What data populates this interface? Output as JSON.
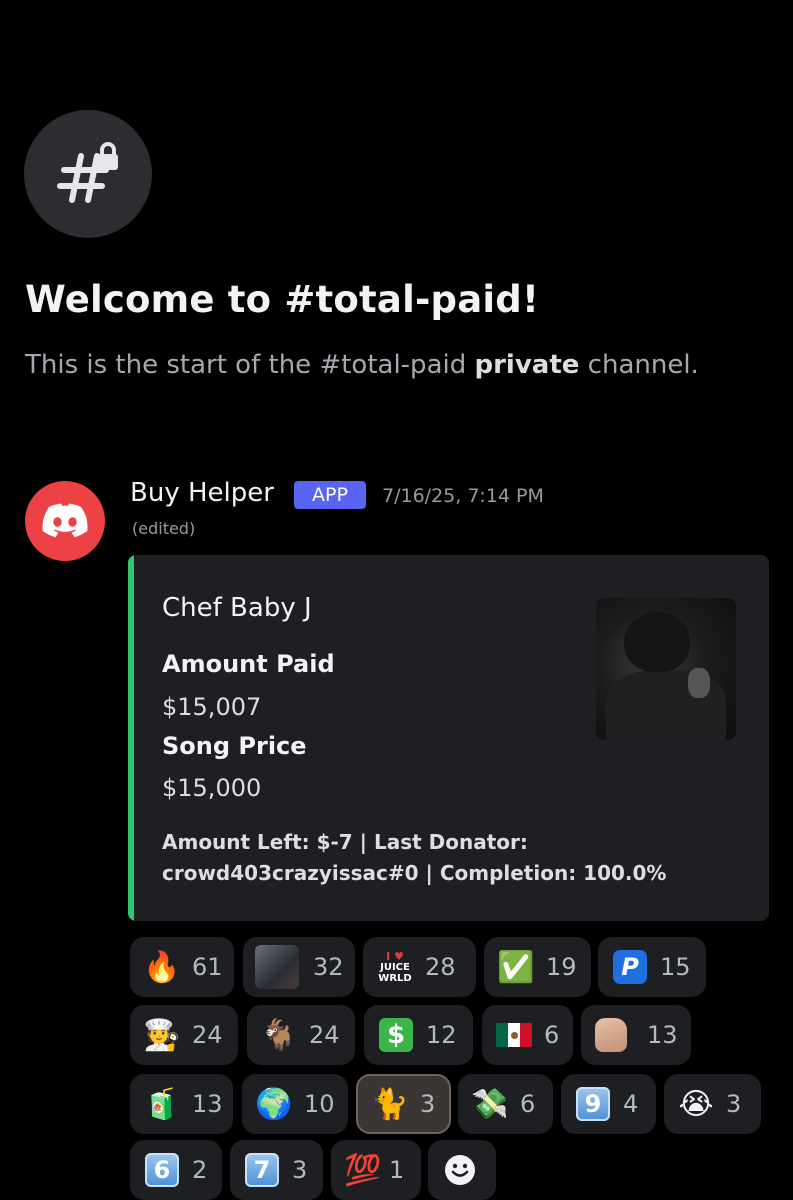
{
  "welcome": {
    "title": "Welcome to #total-paid!",
    "subtitle_start": "This is the start of the #total-paid ",
    "subtitle_bold": "private",
    "subtitle_end": " channel."
  },
  "message": {
    "author": "Buy Helper",
    "badge": "APP",
    "timestamp": "7/16/25, 7:14 PM",
    "edited": "(edited)",
    "embed": {
      "accent_color": "#2dc770",
      "title": "Chef Baby J",
      "fields": [
        {
          "name": "Amount Paid",
          "value": "$15,007"
        },
        {
          "name": "Song Price",
          "value": "$15,000"
        }
      ],
      "description_line1": "Amount Left: $-7 | Last Donator:",
      "description_line2": "crowd403crazyissac#0 | Completion: 100.0%"
    }
  },
  "reactions": [
    {
      "icon": "fire",
      "glyph": "🔥",
      "count": "61"
    },
    {
      "icon": "photo",
      "count": "32"
    },
    {
      "icon": "juice-wrld-logo",
      "logo_top": "I ♥",
      "logo_mid": "JUICE",
      "logo_bot": "WRLD",
      "count": "28"
    },
    {
      "icon": "check-mark",
      "glyph": "✅",
      "count": "19"
    },
    {
      "icon": "paypal",
      "glyph": "P",
      "count": "15"
    },
    {
      "icon": "cook",
      "glyph": "🧑‍🍳",
      "count": "24"
    },
    {
      "icon": "goat",
      "glyph": "🐐",
      "count": "24"
    },
    {
      "icon": "dollar",
      "glyph": "$",
      "count": "12"
    },
    {
      "icon": "mexico-flag",
      "glyph": "🇲🇽",
      "count": "6"
    },
    {
      "icon": "fist",
      "count": "13"
    },
    {
      "icon": "juice-box",
      "glyph": "🧃",
      "count": "13"
    },
    {
      "icon": "globe",
      "glyph": "🌍",
      "count": "10"
    },
    {
      "icon": "cat",
      "glyph": "🐈",
      "count": "3"
    },
    {
      "icon": "money-wings",
      "glyph": "💸",
      "count": "6"
    },
    {
      "icon": "keycap-nine",
      "glyph": "9",
      "count": "4"
    },
    {
      "icon": "crying-face",
      "glyph": "😭",
      "count": "3"
    },
    {
      "icon": "keycap-six",
      "glyph": "6",
      "count": "2"
    },
    {
      "icon": "keycap-seven",
      "glyph": "7",
      "count": "3"
    },
    {
      "icon": "hundred-points",
      "glyph": "💯",
      "count": "1"
    }
  ],
  "colors": {
    "background": "#000000",
    "embed_bg": "#1e1f22",
    "badge": "#5865f2",
    "avatar": "#ed4245"
  }
}
